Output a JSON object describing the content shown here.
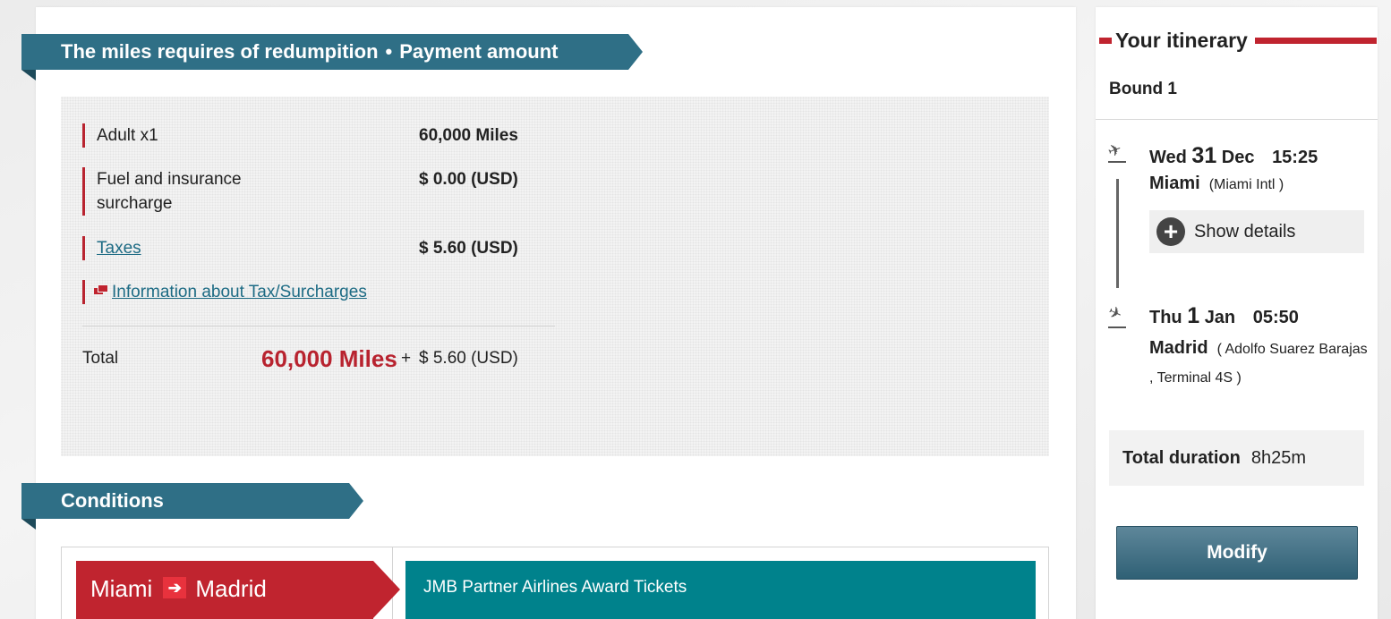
{
  "payment": {
    "banner_part1": "The miles requires of redumpition",
    "banner_sep": "•",
    "banner_part2": "Payment amount",
    "rows": [
      {
        "label": "Adult x1",
        "value": "60,000 Miles"
      },
      {
        "label": "Fuel and insurance surcharge",
        "value": "$ 0.00 (USD)"
      },
      {
        "label": "Taxes",
        "value": "$ 5.60 (USD)"
      }
    ],
    "info_link": "Information about Tax/Surcharges",
    "total_label": "Total",
    "total_miles": "60,000 Miles",
    "total_plus": "+",
    "total_usd": "$ 5.60 (USD)"
  },
  "conditions": {
    "banner": "Conditions",
    "origin": "Miami",
    "destination": "Madrid",
    "award_type": "JMB Partner Airlines Award Tickets"
  },
  "itinerary": {
    "title": "Your itinerary",
    "bound": "Bound 1",
    "departure": {
      "weekday": "Wed",
      "day": "31",
      "month": "Dec",
      "time": "15:25",
      "city": "Miami",
      "airport": "(Miami Intl )"
    },
    "show_details": "Show details",
    "arrival": {
      "weekday": "Thu",
      "day": "1",
      "month": "Jan",
      "time": "05:50",
      "city": "Madrid",
      "airport": "( Adolfo Suarez Barajas , Terminal 4S )"
    },
    "duration_label": "Total duration",
    "duration_value": "8h25m",
    "modify_label": "Modify"
  },
  "colors": {
    "banner": "#2f6f86",
    "accent_red": "#c0242f",
    "award_teal": "#00828c",
    "link": "#1d6b84"
  },
  "icons": {
    "departure": "plane-takeoff-icon",
    "arrival": "plane-landing-icon",
    "show_details": "plus-circle-icon",
    "external": "external-window-icon",
    "route_arrow": "arrow-right-icon"
  }
}
